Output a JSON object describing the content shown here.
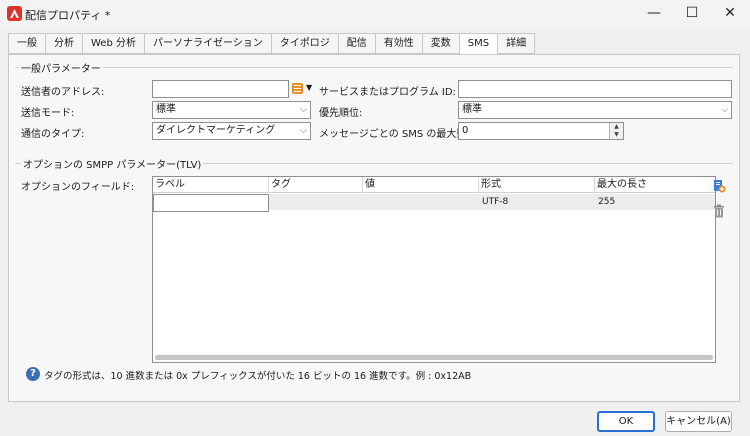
{
  "window": {
    "title": "配信プロパティ *"
  },
  "tabs": [
    "一般",
    "分析",
    "Web 分析",
    "パーソナライゼーション",
    "タイポロジ",
    "配信",
    "有効性",
    "変数",
    "SMS",
    "詳細"
  ],
  "active_tab": "SMS",
  "general": {
    "title": "一般パラメーター",
    "sender_address_label": "送信者のアドレス:",
    "sender_address_value": "",
    "service_id_label": "サービスまたはプログラム ID:",
    "service_id_value": "",
    "send_mode_label": "送信モード:",
    "send_mode_value": "標準",
    "priority_label": "優先順位:",
    "priority_value": "標準",
    "comm_type_label": "通信のタイプ:",
    "comm_type_value": "ダイレクトマーケティング",
    "max_sms_label": "メッセージごとの SMS の最大数:",
    "max_sms_value": "0"
  },
  "smpp": {
    "title": "オプションの SMPP パラメーター(TLV)",
    "fields_label": "オプションのフィールド:",
    "columns": [
      "ラベル",
      "タグ",
      "値",
      "形式",
      "最大の長さ"
    ],
    "row": {
      "label": "",
      "tag": "",
      "value": "",
      "format": "UTF-8",
      "max_length": "255"
    }
  },
  "info": {
    "text": "タグの形式は、10 進数または 0x プレフィックスが付いた 16 ビットの 16 進数です。例 : 0x12AB"
  },
  "buttons": {
    "ok": "OK",
    "cancel": "キャンセル(A)"
  },
  "colors": {
    "accent": "#2a6fd0",
    "brand": "#e0312b"
  }
}
